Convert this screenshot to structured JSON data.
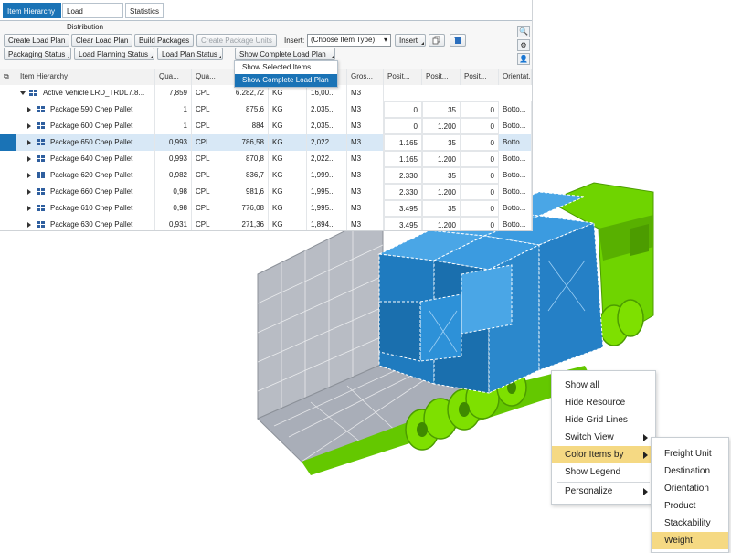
{
  "tabs": [
    {
      "label": "Item Hierarchy",
      "active": true
    },
    {
      "label": "Load Distribution",
      "active": false
    },
    {
      "label": "Statistics",
      "active": false
    }
  ],
  "toolbar": {
    "create_load_plan": "Create Load Plan",
    "clear_load_plan": "Clear Load Plan",
    "build_packages": "Build Packages",
    "create_package_units": "Create Package Units",
    "insert_label": "Insert:",
    "item_type_value": "(Choose Item Type)",
    "insert_button": "Insert",
    "packaging_status": "Packaging Status",
    "load_planning_status": "Load Planning Status",
    "load_plan_status": "Load Plan Status",
    "show_complete_load_plan": "Show Complete Load Plan"
  },
  "dropdown": {
    "items": [
      {
        "label": "Show Selected Items",
        "selected": false
      },
      {
        "label": "Show Complete Load Plan",
        "selected": true
      }
    ]
  },
  "grid": {
    "headers": [
      "Item Hierarchy",
      "Qua...",
      "Qua...",
      "Gros...",
      "Posit...",
      "Posit...",
      "Posit...",
      "Orientat..."
    ],
    "parent_row": {
      "name": "Active Vehicle LRD_TRDL7.8...",
      "qty": "7,859",
      "unit": "CPL",
      "weight": "6.282,72",
      "wunit": "KG",
      "vol": "16,00...",
      "vunit": "M3"
    },
    "rows": [
      {
        "name": "Package 590 Chep Pallet",
        "qty": "1",
        "unit": "CPL",
        "weight": "875,6",
        "wunit": "KG",
        "vol": "2,035...",
        "vunit": "M3",
        "px": "0",
        "py": "35",
        "pz": "0",
        "orient": "Botto...",
        "selected": false
      },
      {
        "name": "Package 600 Chep Pallet",
        "qty": "1",
        "unit": "CPL",
        "weight": "884",
        "wunit": "KG",
        "vol": "2,035...",
        "vunit": "M3",
        "px": "0",
        "py": "1.200",
        "pz": "0",
        "orient": "Botto...",
        "selected": false
      },
      {
        "name": "Package 650 Chep Pallet",
        "qty": "0,993",
        "unit": "CPL",
        "weight": "786,58",
        "wunit": "KG",
        "vol": "2,022...",
        "vunit": "M3",
        "px": "1.165",
        "py": "35",
        "pz": "0",
        "orient": "Botto...",
        "selected": true
      },
      {
        "name": "Package 640 Chep Pallet",
        "qty": "0,993",
        "unit": "CPL",
        "weight": "870,8",
        "wunit": "KG",
        "vol": "2,022...",
        "vunit": "M3",
        "px": "1.165",
        "py": "1.200",
        "pz": "0",
        "orient": "Botto...",
        "selected": false
      },
      {
        "name": "Package 620 Chep Pallet",
        "qty": "0,982",
        "unit": "CPL",
        "weight": "836,7",
        "wunit": "KG",
        "vol": "1,999...",
        "vunit": "M3",
        "px": "2.330",
        "py": "35",
        "pz": "0",
        "orient": "Botto...",
        "selected": false
      },
      {
        "name": "Package 660 Chep Pallet",
        "qty": "0,98",
        "unit": "CPL",
        "weight": "981,6",
        "wunit": "KG",
        "vol": "1,995...",
        "vunit": "M3",
        "px": "2.330",
        "py": "1.200",
        "pz": "0",
        "orient": "Botto...",
        "selected": false
      },
      {
        "name": "Package 610 Chep Pallet",
        "qty": "0,98",
        "unit": "CPL",
        "weight": "776,08",
        "wunit": "KG",
        "vol": "1,995...",
        "vunit": "M3",
        "px": "3.495",
        "py": "35",
        "pz": "0",
        "orient": "Botto...",
        "selected": false
      },
      {
        "name": "Package 630 Chep Pallet",
        "qty": "0,931",
        "unit": "CPL",
        "weight": "271,36",
        "wunit": "KG",
        "vol": "1,894...",
        "vunit": "M3",
        "px": "3.495",
        "py": "1.200",
        "pz": "0",
        "orient": "Botto...",
        "selected": false
      }
    ]
  },
  "context_menu": {
    "items": [
      {
        "label": "Show all",
        "submenu": false,
        "highlighted": false
      },
      {
        "label": "Hide Resource",
        "submenu": false,
        "highlighted": false
      },
      {
        "label": "Hide Grid Lines",
        "submenu": false,
        "highlighted": false
      },
      {
        "label": "Switch View",
        "submenu": true,
        "highlighted": false
      },
      {
        "label": "Color Items by",
        "submenu": true,
        "highlighted": true
      },
      {
        "label": "Show Legend",
        "submenu": false,
        "highlighted": false
      },
      {
        "label": "Personalize",
        "submenu": true,
        "highlighted": false
      }
    ]
  },
  "submenu": {
    "items": [
      {
        "label": "Freight Unit",
        "highlighted": false
      },
      {
        "label": "Destination",
        "highlighted": false
      },
      {
        "label": "Orientation",
        "highlighted": false
      },
      {
        "label": "Product",
        "highlighted": false
      },
      {
        "label": "Stackability",
        "highlighted": false
      },
      {
        "label": "Weight",
        "highlighted": true
      }
    ]
  },
  "colors": {
    "accent": "#1a73b6",
    "truck_green": "#6fd400",
    "cargo_blue": "#2c8fd6",
    "menu_highlight": "#f5d983"
  }
}
